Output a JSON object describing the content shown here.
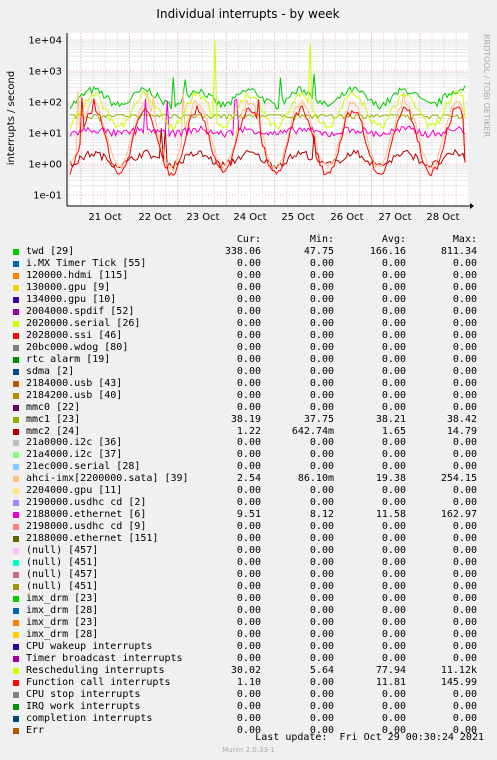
{
  "chart_data": {
    "type": "line",
    "title": "Individual interrupts - by week",
    "ylabel": "interrupts / second",
    "y_scale": "log",
    "y_ticks": [
      "1e-01",
      "1e+00",
      "1e+01",
      "1e+02",
      "1e+03",
      "1e+04"
    ],
    "x_ticks": [
      "21 Oct",
      "22 Oct",
      "23 Oct",
      "24 Oct",
      "25 Oct",
      "26 Oct",
      "27 Oct",
      "28 Oct"
    ],
    "grid": true,
    "side_text": "RRDTOOL / TOBI OETIKER",
    "legend_headers": {
      "cur": "Cur:",
      "min": "Min:",
      "avg": "Avg:",
      "max": "Max:"
    },
    "series": [
      {
        "name": "twd [29]",
        "color": "#00cc00",
        "cur": "338.06",
        "min": "47.75",
        "avg": "166.16",
        "max": "811.34"
      },
      {
        "name": "i.MX Timer Tick [55]",
        "color": "#0066b3",
        "cur": "0.00",
        "min": "0.00",
        "avg": "0.00",
        "max": "0.00"
      },
      {
        "name": "120000.hdmi [115]",
        "color": "#ff8000",
        "cur": "0.00",
        "min": "0.00",
        "avg": "0.00",
        "max": "0.00"
      },
      {
        "name": "130000.gpu [9]",
        "color": "#ffcc00",
        "cur": "0.00",
        "min": "0.00",
        "avg": "0.00",
        "max": "0.00"
      },
      {
        "name": "134000.gpu [10]",
        "color": "#330099",
        "cur": "0.00",
        "min": "0.00",
        "avg": "0.00",
        "max": "0.00"
      },
      {
        "name": "2004000.spdif [52]",
        "color": "#990099",
        "cur": "0.00",
        "min": "0.00",
        "avg": "0.00",
        "max": "0.00"
      },
      {
        "name": "2020000.serial [26]",
        "color": "#ccff00",
        "cur": "0.00",
        "min": "0.00",
        "avg": "0.00",
        "max": "0.00"
      },
      {
        "name": "2028000.ssi [46]",
        "color": "#ff0000",
        "cur": "0.00",
        "min": "0.00",
        "avg": "0.00",
        "max": "0.00"
      },
      {
        "name": "20bc000.wdog [80]",
        "color": "#808080",
        "cur": "0.00",
        "min": "0.00",
        "avg": "0.00",
        "max": "0.00"
      },
      {
        "name": "rtc alarm [19]",
        "color": "#008f00",
        "cur": "0.00",
        "min": "0.00",
        "avg": "0.00",
        "max": "0.00"
      },
      {
        "name": "sdma [2]",
        "color": "#00487d",
        "cur": "0.00",
        "min": "0.00",
        "avg": "0.00",
        "max": "0.00"
      },
      {
        "name": "2184000.usb [43]",
        "color": "#b35a00",
        "cur": "0.00",
        "min": "0.00",
        "avg": "0.00",
        "max": "0.00"
      },
      {
        "name": "2184200.usb [40]",
        "color": "#b38f00",
        "cur": "0.00",
        "min": "0.00",
        "avg": "0.00",
        "max": "0.00"
      },
      {
        "name": "mmc0 [22]",
        "color": "#6b006b",
        "cur": "0.00",
        "min": "0.00",
        "avg": "0.00",
        "max": "0.00"
      },
      {
        "name": "mmc1 [23]",
        "color": "#8fb300",
        "cur": "38.19",
        "min": "37.75",
        "avg": "38.21",
        "max": "38.42"
      },
      {
        "name": "mmc2 [24]",
        "color": "#b30000",
        "cur": "1.22",
        "min": "642.74m",
        "avg": "1.65",
        "max": "14.79"
      },
      {
        "name": "21a0000.i2c [36]",
        "color": "#bebebe",
        "cur": "0.00",
        "min": "0.00",
        "avg": "0.00",
        "max": "0.00"
      },
      {
        "name": "21a4000.i2c [37]",
        "color": "#80ff80",
        "cur": "0.00",
        "min": "0.00",
        "avg": "0.00",
        "max": "0.00"
      },
      {
        "name": "21ec000.serial [28]",
        "color": "#80c9ff",
        "cur": "0.00",
        "min": "0.00",
        "avg": "0.00",
        "max": "0.00"
      },
      {
        "name": "ahci-imx[2200000.sata] [39]",
        "color": "#ffc080",
        "cur": "2.54",
        "min": "86.10m",
        "avg": "19.38",
        "max": "254.15"
      },
      {
        "name": "2204000.gpu [11]",
        "color": "#ffe680",
        "cur": "0.00",
        "min": "0.00",
        "avg": "0.00",
        "max": "0.00"
      },
      {
        "name": "2190000.usdhc cd [2]",
        "color": "#aa80ff",
        "cur": "0.00",
        "min": "0.00",
        "avg": "0.00",
        "max": "0.00"
      },
      {
        "name": "2188000.ethernet [6]",
        "color": "#ee00cc",
        "cur": "9.51",
        "min": "8.12",
        "avg": "11.58",
        "max": "162.97"
      },
      {
        "name": "2198000.usdhc cd [9]",
        "color": "#ff8080",
        "cur": "0.00",
        "min": "0.00",
        "avg": "0.00",
        "max": "0.00"
      },
      {
        "name": "2188000.ethernet [151]",
        "color": "#666600",
        "cur": "0.00",
        "min": "0.00",
        "avg": "0.00",
        "max": "0.00"
      },
      {
        "name": "(null) [457]",
        "color": "#ffbfff",
        "cur": "0.00",
        "min": "0.00",
        "avg": "0.00",
        "max": "0.00"
      },
      {
        "name": "(null) [451]",
        "color": "#00ffcc",
        "cur": "0.00",
        "min": "0.00",
        "avg": "0.00",
        "max": "0.00"
      },
      {
        "name": "(null) [457]",
        "color": "#cc6699",
        "cur": "0.00",
        "min": "0.00",
        "avg": "0.00",
        "max": "0.00"
      },
      {
        "name": "(null) [451]",
        "color": "#999900",
        "cur": "0.00",
        "min": "0.00",
        "avg": "0.00",
        "max": "0.00"
      },
      {
        "name": "imx_drm [23]",
        "color": "#00cc00",
        "cur": "0.00",
        "min": "0.00",
        "avg": "0.00",
        "max": "0.00"
      },
      {
        "name": "imx_drm [28]",
        "color": "#0066b3",
        "cur": "0.00",
        "min": "0.00",
        "avg": "0.00",
        "max": "0.00"
      },
      {
        "name": "imx_drm [23]",
        "color": "#ff8000",
        "cur": "0.00",
        "min": "0.00",
        "avg": "0.00",
        "max": "0.00"
      },
      {
        "name": "imx_drm [28]",
        "color": "#ffcc00",
        "cur": "0.00",
        "min": "0.00",
        "avg": "0.00",
        "max": "0.00"
      },
      {
        "name": "CPU wakeup interrupts",
        "color": "#330099",
        "cur": "0.00",
        "min": "0.00",
        "avg": "0.00",
        "max": "0.00"
      },
      {
        "name": "Timer broadcast interrupts",
        "color": "#990099",
        "cur": "0.00",
        "min": "0.00",
        "avg": "0.00",
        "max": "0.00"
      },
      {
        "name": "Rescheduling interrupts",
        "color": "#ccff00",
        "cur": "30.02",
        "min": "5.64",
        "avg": "77.94",
        "max": "11.12k"
      },
      {
        "name": "Function call interrupts",
        "color": "#ff0000",
        "cur": "1.10",
        "min": "0.00",
        "avg": "11.81",
        "max": "145.99"
      },
      {
        "name": "CPU stop interrupts",
        "color": "#808080",
        "cur": "0.00",
        "min": "0.00",
        "avg": "0.00",
        "max": "0.00"
      },
      {
        "name": "IRQ work interrupts",
        "color": "#008f00",
        "cur": "0.00",
        "min": "0.00",
        "avg": "0.00",
        "max": "0.00"
      },
      {
        "name": "completion interrupts",
        "color": "#00487d",
        "cur": "0.00",
        "min": "0.00",
        "avg": "0.00",
        "max": "0.00"
      },
      {
        "name": "Err",
        "color": "#b35a00",
        "cur": "0.00",
        "min": "0.00",
        "avg": "0.00",
        "max": "0.00"
      }
    ]
  },
  "footer": {
    "last_update": "Last update:  Fri Oct 29 00:30:24 2021",
    "version": "Munin 2.0.33-1"
  }
}
